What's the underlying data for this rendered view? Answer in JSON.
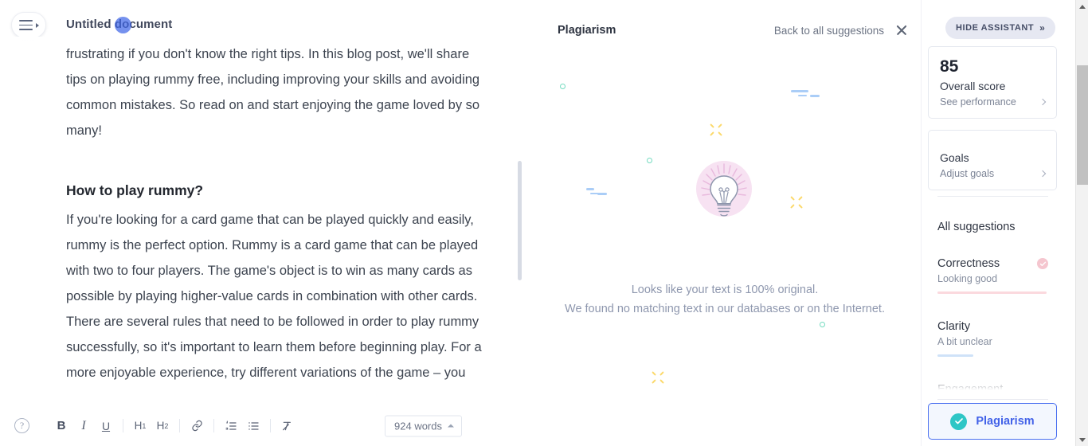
{
  "editor": {
    "menu_icon": "hamburger-menu-icon",
    "title": "Untitled document",
    "paragraph_1": "frustrating if you don't know the right tips. In this blog post, we'll share tips on playing rummy free, including improving your skills and avoiding common mistakes. So read on and start enjoying the game loved by so many!",
    "heading_2": "How to play rummy?",
    "paragraph_2": "If you're looking for a card game that can be played quickly and easily, rummy is the perfect option. Rummy is a card game that can be played with two to four players. The game's object is to win as many cards as possible by playing higher-value cards in combination with other cards. There are several rules that need to be followed in order to play rummy successfully, so it's important to learn them before beginning play. For a more enjoyable experience, try different variations of the game – you"
  },
  "toolbar": {
    "help_label": "?",
    "bold_label": "B",
    "italic_label": "I",
    "underline_label": "U",
    "h1_label": "H",
    "h1_sub": "1",
    "h2_label": "H",
    "h2_sub": "2",
    "link_icon": "link-icon",
    "numbered_list_icon": "numbered-list-icon",
    "bullet_list_icon": "bullet-list-icon",
    "clear_format_icon": "clear-formatting-icon",
    "word_count": "924 words"
  },
  "plagiarism_panel": {
    "title": "Plagiarism",
    "back_link": "Back to all suggestions",
    "close_icon": "close-icon",
    "illustration_icon": "lightbulb-icon",
    "message_line_1": "Looks like your text is 100% original.",
    "message_line_2": "We found no matching text in our databases or on the Internet."
  },
  "sidebar": {
    "hide_assistant_label": "HIDE ASSISTANT",
    "hide_assistant_chevron": "»",
    "score_card": {
      "value": "85",
      "label": "Overall score",
      "sub": "See performance"
    },
    "goals_card": {
      "label": "Goals",
      "sub": "Adjust goals"
    },
    "all_suggestions_label": "All suggestions",
    "suggestions": [
      {
        "name": "Correctness",
        "status": "Looking good",
        "bar_color": "#fbd9de",
        "bar_width": "100%",
        "badge": true,
        "badge_color": "#f5c6cf",
        "badge_icon": "check-icon"
      },
      {
        "name": "Clarity",
        "status": "A bit unclear",
        "bar_color": "#cfe2f8",
        "bar_width": "33%",
        "badge": false
      },
      {
        "name": "Engagement",
        "status": "",
        "bar_color": "#e9ebf1",
        "bar_width": "100%",
        "badge": false
      }
    ],
    "plagiarism_button": {
      "label": "Plagiarism",
      "icon": "check-circle-icon",
      "icon_color": "#2ec6c6",
      "accent_color": "#4262e8"
    }
  },
  "decor": {
    "circle_color": "#74dbc0",
    "dash_color": "#aacdf7",
    "spark_color": "#fbd96b",
    "glow_color": "#f7e2f2"
  }
}
